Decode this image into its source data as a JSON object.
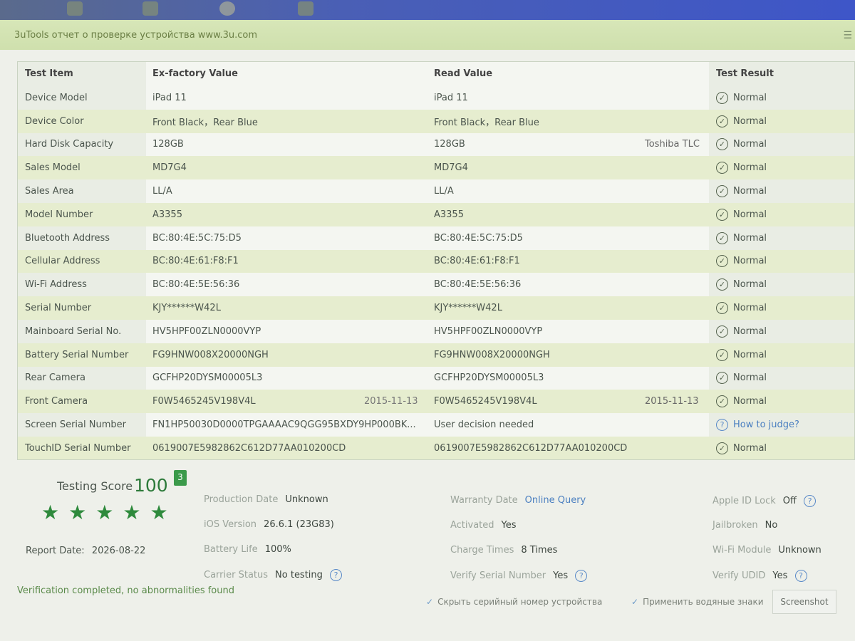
{
  "window": {
    "title": "3uTools отчет о проверке устройства www.3u.com"
  },
  "table": {
    "headers": [
      "Test Item",
      "Ex-factory Value",
      "Read Value",
      "Test Result"
    ],
    "rows": [
      {
        "item": "Device Model",
        "factory": "iPad 11",
        "factory_date": "",
        "read": "iPad 11",
        "read_extra": "",
        "result": "Normal",
        "result_type": "ok"
      },
      {
        "item": "Device Color",
        "factory": "Front Black，Rear Blue",
        "factory_date": "",
        "read": "Front Black，Rear Blue",
        "read_extra": "",
        "result": "Normal",
        "result_type": "ok"
      },
      {
        "item": "Hard Disk Capacity",
        "factory": "128GB",
        "factory_date": "",
        "read": "128GB",
        "read_extra": "Toshiba TLC",
        "result": "Normal",
        "result_type": "ok"
      },
      {
        "item": "Sales Model",
        "factory": "MD7G4",
        "factory_date": "",
        "read": "MD7G4",
        "read_extra": "",
        "result": "Normal",
        "result_type": "ok"
      },
      {
        "item": "Sales Area",
        "factory": "LL/A",
        "factory_date": "",
        "read": "LL/A",
        "read_extra": "",
        "result": "Normal",
        "result_type": "ok"
      },
      {
        "item": "Model Number",
        "factory": "A3355",
        "factory_date": "",
        "read": "A3355",
        "read_extra": "",
        "result": "Normal",
        "result_type": "ok"
      },
      {
        "item": "Bluetooth Address",
        "factory": "BC:80:4E:5C:75:D5",
        "factory_date": "",
        "read": "BC:80:4E:5C:75:D5",
        "read_extra": "",
        "result": "Normal",
        "result_type": "ok"
      },
      {
        "item": "Cellular Address",
        "factory": "BC:80:4E:61:F8:F1",
        "factory_date": "",
        "read": "BC:80:4E:61:F8:F1",
        "read_extra": "",
        "result": "Normal",
        "result_type": "ok"
      },
      {
        "item": "Wi-Fi Address",
        "factory": "BC:80:4E:5E:56:36",
        "factory_date": "",
        "read": "BC:80:4E:5E:56:36",
        "read_extra": "",
        "result": "Normal",
        "result_type": "ok"
      },
      {
        "item": "Serial Number",
        "factory": "KJY******W42L",
        "factory_date": "",
        "read": "KJY******W42L",
        "read_extra": "",
        "result": "Normal",
        "result_type": "ok"
      },
      {
        "item": "Mainboard Serial No.",
        "factory": "HV5HPF00ZLN0000VYP",
        "factory_date": "",
        "read": "HV5HPF00ZLN0000VYP",
        "read_extra": "",
        "result": "Normal",
        "result_type": "ok"
      },
      {
        "item": "Battery Serial Number",
        "factory": "FG9HNW008X20000NGH",
        "factory_date": "",
        "read": "FG9HNW008X20000NGH",
        "read_extra": "",
        "result": "Normal",
        "result_type": "ok"
      },
      {
        "item": "Rear Camera",
        "factory": "GCFHP20DYSM00005L3",
        "factory_date": "",
        "read": "GCFHP20DYSM00005L3",
        "read_extra": "",
        "result": "Normal",
        "result_type": "ok"
      },
      {
        "item": "Front Camera",
        "factory": "F0W5465245V198V4L",
        "factory_date": "2015-11-13",
        "read": "F0W5465245V198V4L",
        "read_extra": "2015-11-13",
        "result": "Normal",
        "result_type": "ok"
      },
      {
        "item": "Screen Serial Number",
        "factory": "FN1HP50030D0000TPGAAAAC9QGG95BXDY9HP000BK...",
        "factory_date": "",
        "read": "User decision needed",
        "read_extra": "",
        "result": "How to judge?",
        "result_type": "question"
      },
      {
        "item": "TouchID Serial Number",
        "factory": "0619007E5982862C612D77AA010200CD",
        "factory_date": "",
        "read": "0619007E5982862C612D77AA010200CD",
        "read_extra": "",
        "result": "Normal",
        "result_type": "ok"
      }
    ]
  },
  "summary": {
    "score_label": "Testing Score",
    "score": "100",
    "badge": "3",
    "stars": 5,
    "report_label": "Report Date:",
    "report_date": "2026-08-22",
    "production_date": {
      "label": "Production Date",
      "value": "Unknown"
    },
    "ios_version": {
      "label": "iOS Version",
      "value": "26.6.1 (23G83)"
    },
    "battery_life": {
      "label": "Battery Life",
      "value": "100%"
    },
    "carrier_status": {
      "label": "Carrier Status",
      "value": "No testing"
    },
    "warranty_date": {
      "label": "Warranty Date",
      "value": "Online Query"
    },
    "activated": {
      "label": "Activated",
      "value": "Yes"
    },
    "charge_times": {
      "label": "Charge Times",
      "value": "8 Times"
    },
    "verify_serial": {
      "label": "Verify Serial Number",
      "value": "Yes"
    },
    "apple_id_lock": {
      "label": "Apple ID Lock",
      "value": "Off"
    },
    "jailbroken": {
      "label": "Jailbroken",
      "value": "No"
    },
    "wifi_module": {
      "label": "Wi-Fi Module",
      "value": "Unknown"
    },
    "verify_udid": {
      "label": "Verify UDID",
      "value": "Yes"
    },
    "verification": "Verification completed, no abnormalities found"
  },
  "footer": {
    "hide_serial": "Скрыть серийный номер устройства",
    "apply_watermark": "Применить водяные знаки",
    "screenshot": "Screenshot"
  },
  "colors": {
    "accent_green": "#2e8a3c",
    "link_blue": "#4a7fc0",
    "row_alt": "#e6edcf"
  }
}
